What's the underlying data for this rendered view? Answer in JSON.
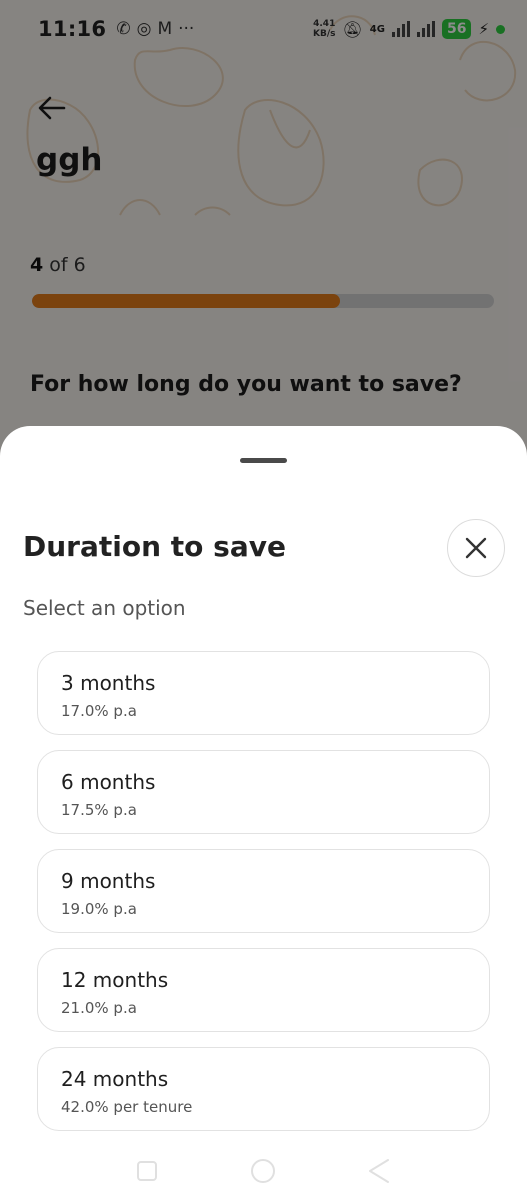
{
  "status_bar": {
    "time": "11:16",
    "net_speed_value": "4.41",
    "net_speed_unit": "KB/s",
    "network_type": "4G",
    "battery": "56",
    "left_icons": [
      "phone-icon",
      "whatsapp-icon",
      "gmail-icon",
      "more-dots-icon"
    ]
  },
  "header": {
    "title": "ggh"
  },
  "progress": {
    "current": "4",
    "separator": " of ",
    "total": "6",
    "fraction": 0.667,
    "fill_color": "#e07b1a"
  },
  "question": "For how long do you want to save?",
  "bottom_sheet": {
    "title": "Duration to save",
    "subtitle": "Select an option",
    "options": [
      {
        "label": "3 months",
        "rate": "17.0% p.a"
      },
      {
        "label": "6 months",
        "rate": "17.5% p.a"
      },
      {
        "label": "9 months",
        "rate": "19.0% p.a"
      },
      {
        "label": "12 months",
        "rate": "21.0% p.a"
      },
      {
        "label": "24 months",
        "rate": "42.0% per tenure"
      }
    ]
  },
  "nav_bar": {
    "buttons": [
      "recent-apps-icon",
      "home-icon",
      "back-icon"
    ]
  }
}
